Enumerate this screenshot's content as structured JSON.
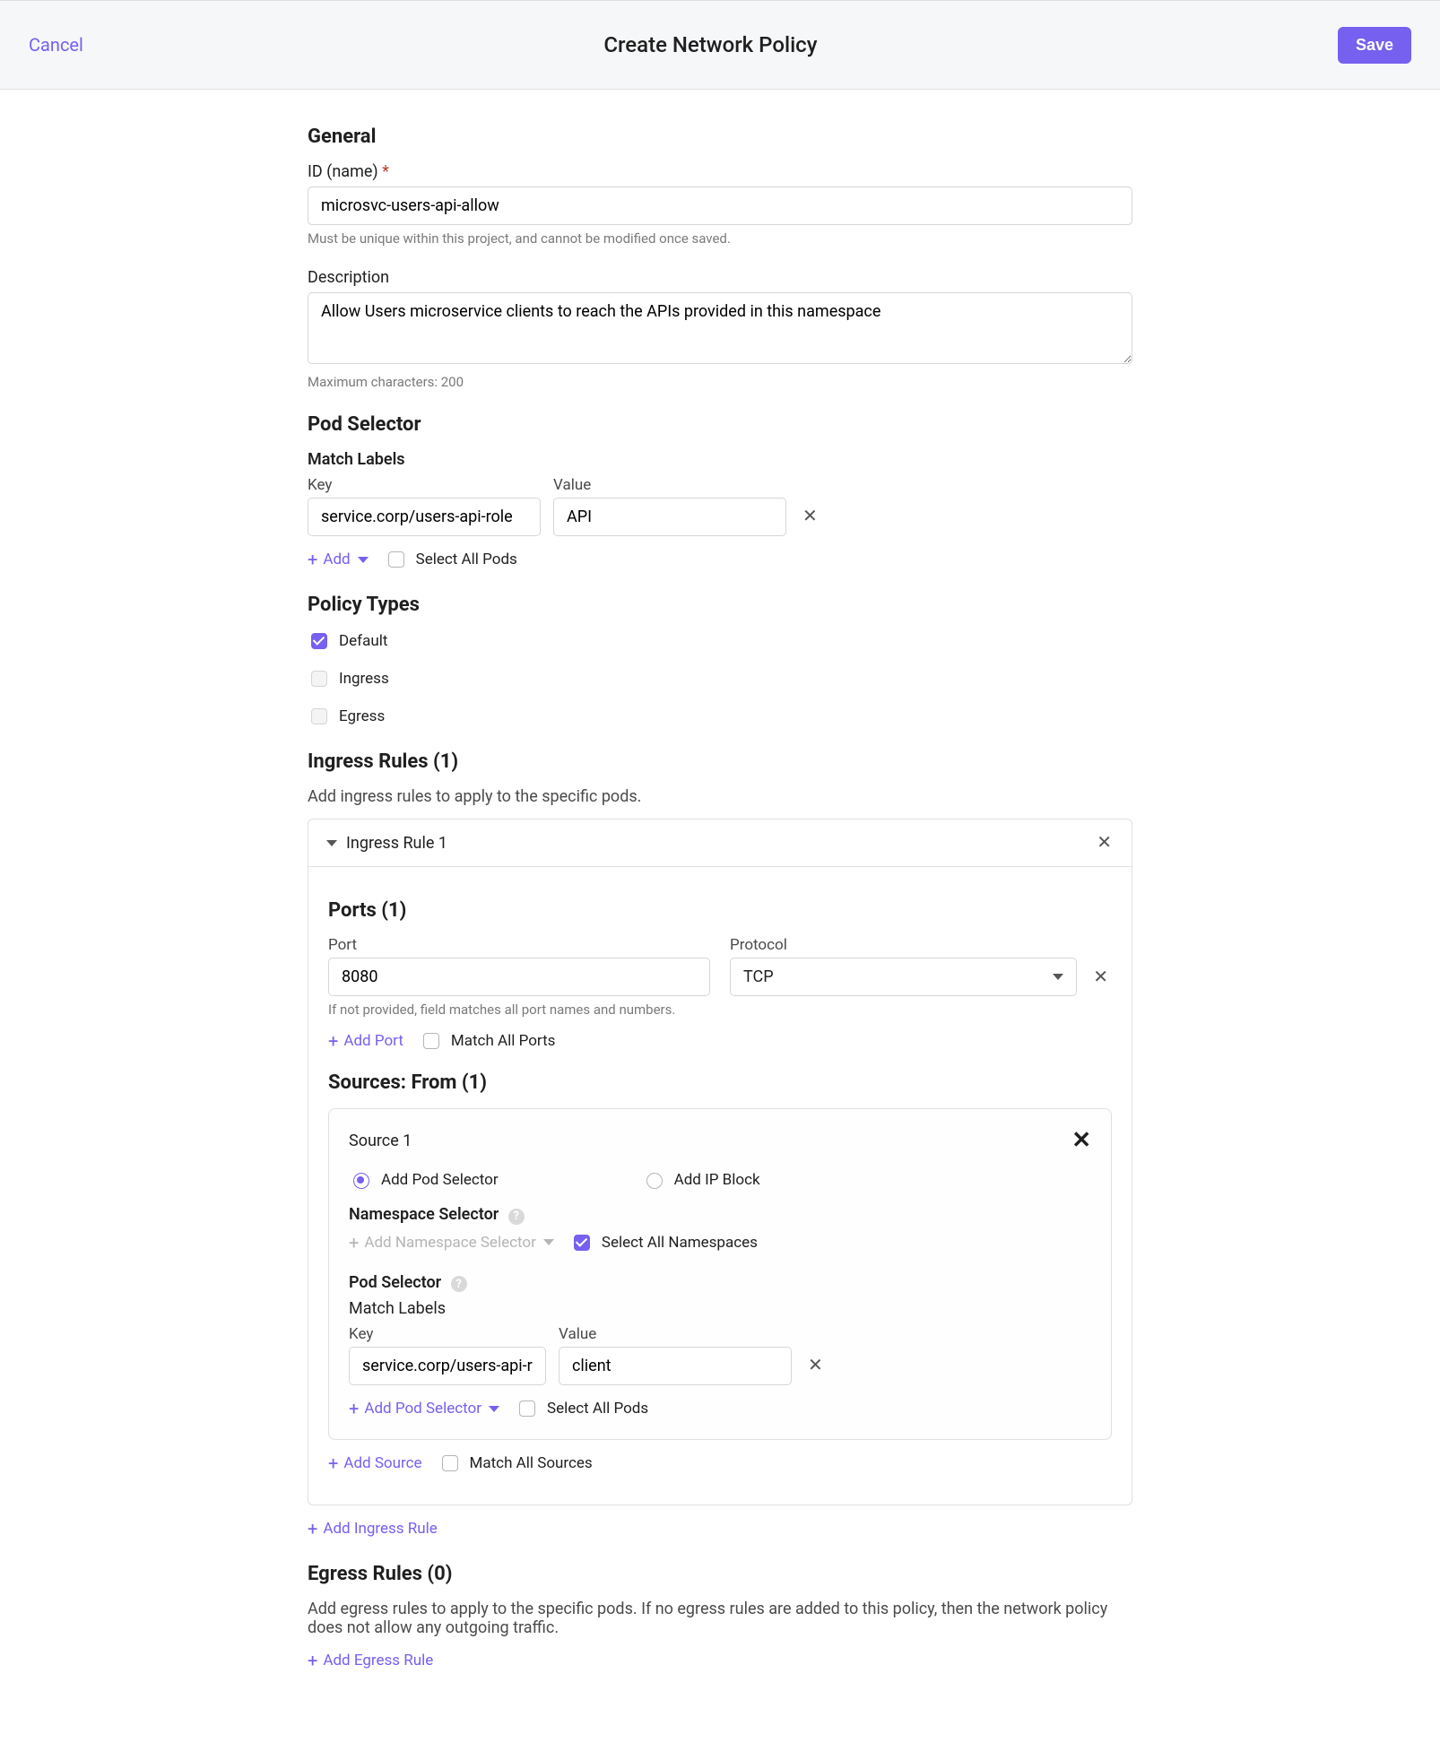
{
  "topbar": {
    "cancel": "Cancel",
    "title": "Create Network Policy",
    "save": "Save"
  },
  "general": {
    "heading": "General",
    "id_label": "ID (name)",
    "id_value": "microsvc-users-api-allow",
    "id_help": "Must be unique within this project, and cannot be modified once saved.",
    "desc_label": "Description",
    "desc_value": "Allow Users microservice clients to reach the APIs provided in this namespace",
    "desc_help": "Maximum characters: 200"
  },
  "podSelector": {
    "heading": "Pod Selector",
    "matchLabels": "Match Labels",
    "keyHead": "Key",
    "valHead": "Value",
    "rows": [
      {
        "key": "service.corp/users-api-role",
        "value": "API"
      }
    ],
    "add": "Add",
    "selectAll": "Select All Pods"
  },
  "policyTypes": {
    "heading": "Policy Types",
    "default": "Default",
    "ingress": "Ingress",
    "egress": "Egress"
  },
  "ingress": {
    "heading": "Ingress Rules (1)",
    "desc": "Add ingress rules to apply to the specific pods.",
    "ruleTitle": "Ingress Rule 1",
    "ports": {
      "heading": "Ports (1)",
      "portLabel": "Port",
      "portValue": "8080",
      "portHelp": "If not provided, field matches all port names and numbers.",
      "protocolLabel": "Protocol",
      "protocolValue": "TCP",
      "addPort": "Add Port",
      "matchAll": "Match All Ports"
    },
    "sources": {
      "heading": "Sources: From (1)",
      "source1": "Source 1",
      "addPodSel": "Add Pod Selector",
      "addIpBlock": "Add IP Block",
      "nsSel": "Namespace Selector",
      "addNsSel": "Add Namespace Selector",
      "selAllNs": "Select All Namespaces",
      "podSel": "Pod Selector",
      "matchLabels": "Match Labels",
      "keyHead": "Key",
      "valHead": "Value",
      "rows": [
        {
          "key": "service.corp/users-api-role",
          "value": "client"
        }
      ],
      "addPodSelector": "Add Pod Selector",
      "selAllPods": "Select All Pods",
      "addSource": "Add Source",
      "matchAllSources": "Match All Sources"
    },
    "addIngress": "Add Ingress Rule"
  },
  "egress": {
    "heading": "Egress Rules (0)",
    "desc": "Add egress rules to apply to the specific pods. If no egress rules are added to this policy, then the network policy does not allow any outgoing traffic.",
    "addEgress": "Add Egress Rule"
  }
}
